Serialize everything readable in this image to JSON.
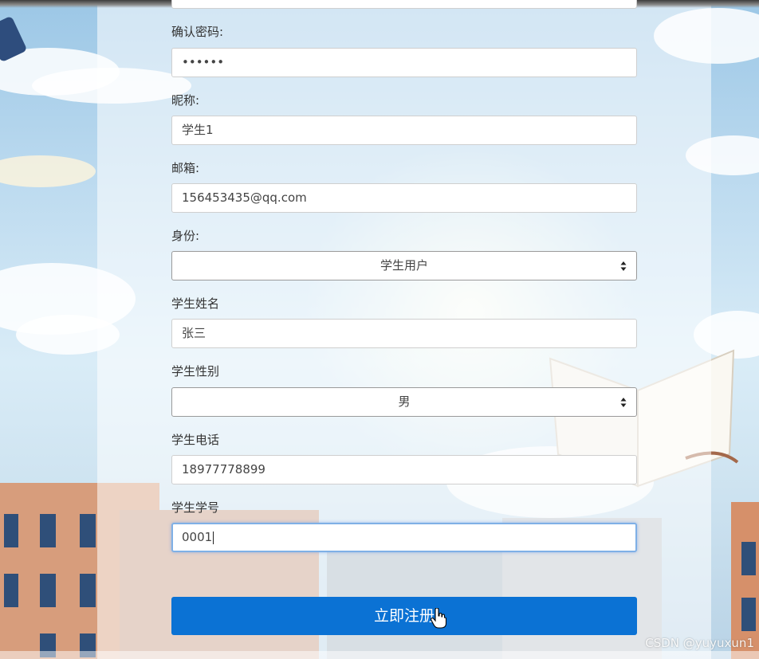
{
  "form": {
    "confirm_password": {
      "label": "确认密码:",
      "value": "••••••"
    },
    "nickname": {
      "label": "昵称:",
      "value": "学生1"
    },
    "email": {
      "label": "邮箱:",
      "value": "156453435@qq.com"
    },
    "role": {
      "label": "身份:",
      "selected": "学生用户"
    },
    "student_name": {
      "label": "学生姓名",
      "value": "张三"
    },
    "student_gender": {
      "label": "学生性别",
      "selected": "男"
    },
    "student_phone": {
      "label": "学生电话",
      "value": "18977778899"
    },
    "student_id": {
      "label": "学生学号",
      "value": "0001"
    },
    "submit_label": "立即注册"
  },
  "watermark": "CSDN @yuyuxun1",
  "colors": {
    "primary_button": "#0b72d4",
    "focus_border": "#7fb0e6"
  }
}
